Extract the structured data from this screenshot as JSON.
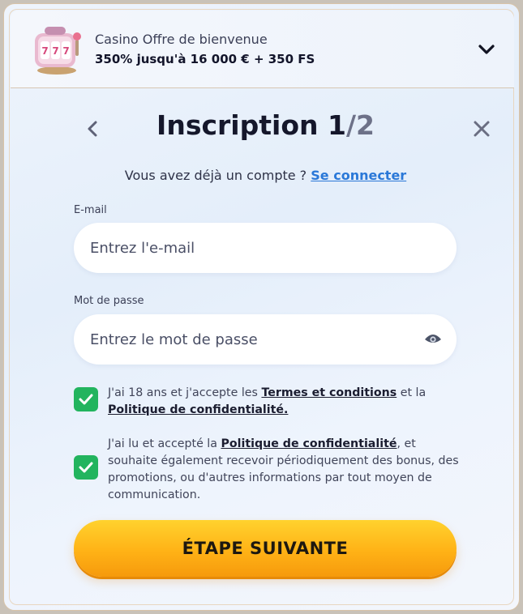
{
  "bonus": {
    "title": "Casino Offre de bienvenue",
    "amount": "350% jusqu'à 16 000 € + 350 FS"
  },
  "header": {
    "title_prefix": "Inscription 1",
    "title_total": "/2"
  },
  "login": {
    "prompt": "Vous avez déjà un compte ?",
    "link": "Se connecter"
  },
  "form": {
    "email_label": "E-mail",
    "email_placeholder": "Entrez l'e-mail",
    "password_label": "Mot de passe",
    "password_placeholder": "Entrez le mot de passe"
  },
  "consent": {
    "terms_pre": "J'ai 18 ans et j'accepte les ",
    "terms_link": "Termes et conditions",
    "terms_mid": " et la ",
    "privacy_link": "Politique de confidentialité.",
    "marketing_pre": "J'ai lu et accepté la ",
    "marketing_link": "Politique de confidentialité",
    "marketing_post": ", et souhaite également recevoir périodiquement des bonus, des promotions, ou d'autres informations par tout moyen de communication."
  },
  "cta": {
    "label": "ÉTAPE SUIVANTE"
  },
  "colors": {
    "accent_link": "#2a78d8",
    "check_green": "#22b45e",
    "cta_orange": "#ffb216"
  }
}
